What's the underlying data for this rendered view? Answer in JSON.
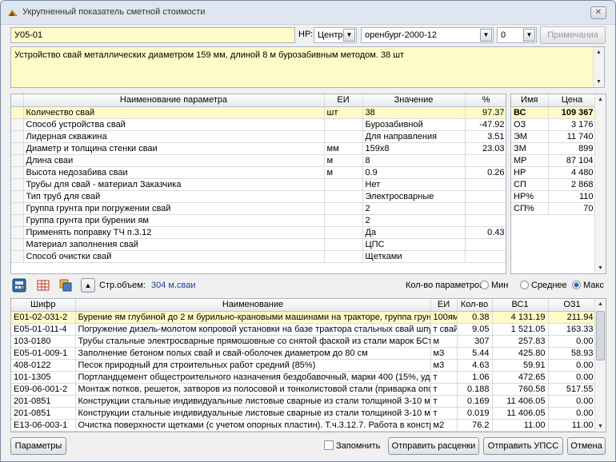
{
  "window": {
    "title": "Укрупненный показатель сметной стоимости",
    "close_label": "✕"
  },
  "top": {
    "code": "У05-01",
    "np_label": "НР:",
    "np_value": "Центр",
    "base_value": "оренбург-2000-12",
    "index_value": "0",
    "notes_label": "Примечания"
  },
  "description": "Устройство свай металлических диаметром 159 мм, длиной 8 м бурозабивным методом. 38 шт",
  "params": {
    "headers": [
      "Наименование параметра",
      "ЕИ",
      "Значение",
      "%"
    ],
    "rows": [
      [
        "Количество свай",
        "шт",
        "38",
        "97.37"
      ],
      [
        "Способ устройства свай",
        "",
        "Бурозабивной",
        "-47.92"
      ],
      [
        "Лидерная скважина",
        "",
        "Для направления",
        "3.51"
      ],
      [
        "Диаметр и толщина стенки сваи",
        "мм",
        "159х8",
        "23.03"
      ],
      [
        "Длина сваи",
        "м",
        "8",
        ""
      ],
      [
        "Высота недозабива сваи",
        "м",
        "0.9",
        "0.26"
      ],
      [
        "Трубы для свай - материал Заказчика",
        "",
        "Нет",
        ""
      ],
      [
        "Тип труб для свай",
        "",
        "Электросварные",
        ""
      ],
      [
        "Группа грунта при погружении свай",
        "",
        "2",
        ""
      ],
      [
        "Группа грунта при бурении ям",
        "",
        "2",
        ""
      ],
      [
        "Применять поправку ТЧ п.3.12",
        "",
        "Да",
        "0.43"
      ],
      [
        "Материал заполнения свай",
        "",
        "ЦПС",
        ""
      ],
      [
        "Способ очистки свай",
        "",
        "Щетками",
        ""
      ]
    ]
  },
  "prices": {
    "headers": [
      "Имя",
      "Цена"
    ],
    "rows": [
      [
        "ВС",
        "109 367"
      ],
      [
        "ОЗ",
        "3 176"
      ],
      [
        "ЭМ",
        "11 740"
      ],
      [
        "ЗМ",
        "899"
      ],
      [
        "МР",
        "87 104"
      ],
      [
        "НР",
        "4 480"
      ],
      [
        "СП",
        "2 868"
      ],
      [
        "НР%",
        "110"
      ],
      [
        "СП%",
        "70"
      ]
    ]
  },
  "toolbar": {
    "volume_label": "Стр.объем:",
    "volume_value": "304 м.сваи",
    "count_label": "Кол-во параметров:",
    "opt_min": "Мин",
    "opt_mid": "Среднее",
    "opt_max": "Макс"
  },
  "resources": {
    "headers": [
      "Шифр",
      "Наименование",
      "ЕИ",
      "Кол-во",
      "ВС1",
      "ОЗ1"
    ],
    "rows": [
      [
        "Е01-02-031-2",
        "Бурение ям глубиной до 2 м бурильно-крановыми машинами на тракторе, группа грунто",
        "100ям",
        "0.38",
        "4 131.19",
        "211.94"
      ],
      [
        "Е05-01-011-4",
        "Погружение дизель-молотом копровой установки на базе трактора стальных свай шпунт",
        "т свай",
        "9.05",
        "1 521.05",
        "163.33"
      ],
      [
        "103-0180",
        "Трубы стальные электросварные прямошовные со снятой фаской из стали марок БСт2к",
        "м",
        "307",
        "257.83",
        "0.00"
      ],
      [
        "Е05-01-009-1",
        "Заполнение бетоном полых свай и свай-оболочек диаметром до 80 см",
        "м3",
        "5.44",
        "425.80",
        "58.93"
      ],
      [
        "408-0122",
        "Песок природный для строительных работ средний (85%)",
        "м3",
        "4.63",
        "59.91",
        "0.00"
      ],
      [
        "101-1305",
        "Портландцемент общестроительного назначения бездобавочный, марки 400 (15%, уд.в",
        "т",
        "1.06",
        "472.65",
        "0.00"
      ],
      [
        "Е09-06-001-2",
        "Монтаж потков, решеток, затворов из полосовой и тонколистовой стали (приварка опорн",
        "т",
        "0.188",
        "760.58",
        "517.55"
      ],
      [
        "201-0851",
        "Конструкции стальные индивидуальные листовые сварные из стали толщиной 3-10 мм п",
        "т",
        "0.169",
        "11 406.05",
        "0.00"
      ],
      [
        "201-0851",
        "Конструкции стальные индивидуальные листовые сварные из стали толщиной 3-10 мм п",
        "т",
        "0.019",
        "11 406.05",
        "0.00"
      ],
      [
        "Е13-06-003-1",
        "Очистка поверхности щетками (с учетом опорных пластин). Т.ч.3.12.7. Работа в констру",
        "м2",
        "76.2",
        "11.00",
        "11.00"
      ]
    ]
  },
  "bottom": {
    "params_btn": "Параметры",
    "remember_label": "Запомнить",
    "send_rates": "Отправить расценки",
    "send_upss": "Отправить УПСС",
    "cancel": "Отмена"
  }
}
